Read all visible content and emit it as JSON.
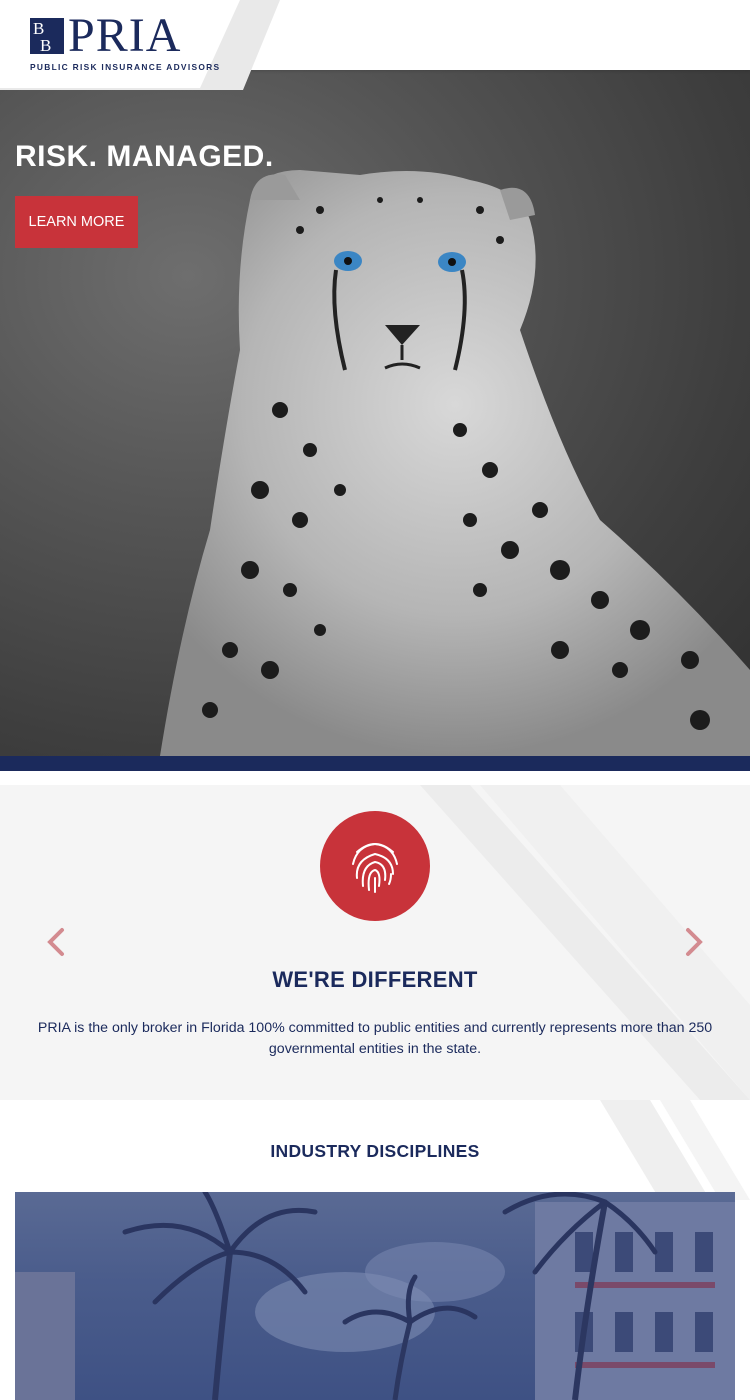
{
  "header": {
    "logo_mark_top": "B",
    "logo_mark_bottom": "B",
    "logo_word": "PRIA",
    "logo_tagline": "PUBLIC RISK INSURANCE ADVISORS",
    "menu_icon": "hamburger-menu-icon"
  },
  "hero": {
    "title": "RISK. MANAGED.",
    "button_label": "LEARN MORE",
    "image": "cheetah-photo"
  },
  "different": {
    "icon": "fingerprint-icon",
    "prev_icon": "chevron-left-icon",
    "next_icon": "chevron-right-icon",
    "title": "WE'RE DIFFERENT",
    "text": "PRIA is the only broker in Florida 100% committed to public entities and currently represents more than 250 governmental entities in the state."
  },
  "disciplines": {
    "title": "INDUSTRY DISCIPLINES",
    "image": "palm-trees-building-photo"
  },
  "colors": {
    "navy": "#1b2a5c",
    "red": "#c8333a",
    "light_gray": "#f5f5f5"
  }
}
